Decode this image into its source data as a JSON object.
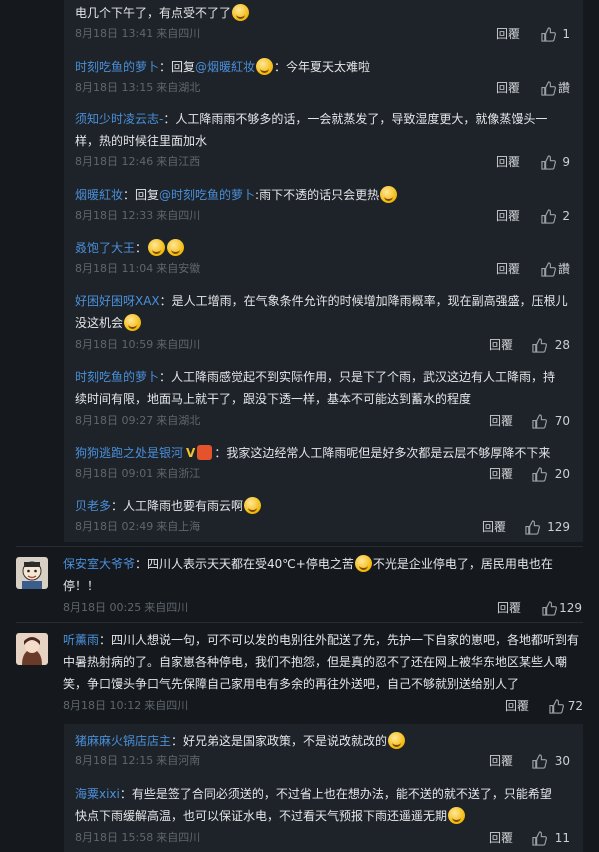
{
  "reply_label": "回覆",
  "like_icon": "thumbs-up-icon",
  "colors": {
    "link": "#4a8fd9",
    "background": "#15191e",
    "panel": "#1e2329",
    "meta": "#5f666e"
  },
  "replies_a": [
    {
      "name": "",
      "text": "电几个下午了，有点受不了了",
      "emoji_after": true,
      "date": "8月18日 13:41",
      "location": "来自四川",
      "likes": "1"
    },
    {
      "name": "时刻吃鱼的萝卜",
      "prefix": "：回复",
      "at": "@烟暖紅妆",
      "text": "：今年夏天太难啦",
      "emoji_mid": true,
      "date": "8月18日 13:15",
      "location": "来自湖北",
      "likes": "讚"
    },
    {
      "name": "须知少时凌云志-",
      "text": "：人工降雨雨不够多的话，一会就蒸发了，导致湿度更大，就像蒸馒头一样，热的时候往里面加水",
      "date": "8月18日 12:46",
      "location": "来自江西",
      "likes": "9"
    },
    {
      "name": "烟暖紅妆",
      "prefix": "：回复",
      "at": "@时刻吃鱼的萝卜",
      "text": ":雨下不透的话只会更热",
      "emoji_after": true,
      "date": "8月18日 12:33",
      "location": "来自四川",
      "likes": "2"
    },
    {
      "name": "叒饱了大王",
      "text": "：",
      "emoji_two": true,
      "date": "8月18日 11:04",
      "location": "来自安徽",
      "likes": "讚"
    },
    {
      "name": "好困好困呀XAX",
      "text": "：是人工增雨，在气象条件允许的时候增加降雨概率，现在副高强盛，压根儿没这机会",
      "emoji_after": true,
      "date": "8月18日 10:59",
      "location": "来自四川",
      "likes": "28"
    },
    {
      "name": "时刻吃鱼的萝卜",
      "text": "：人工降雨感觉起不到实际作用，只是下了个雨，武汉这边有人工降雨，持续时间有限，地面马上就干了，跟没下透一样，基本不可能达到蓄水的程度",
      "date": "8月18日 09:27",
      "location": "来自湖北",
      "likes": "70"
    },
    {
      "name": "狗狗逃跑之处是银河",
      "badge": "V",
      "text": "：我家这边经常人工降雨呢但是好多次都是云层不够厚降不下来",
      "date": "8月18日 09:01",
      "location": "来自浙江",
      "likes": "20"
    },
    {
      "name": "贝老多",
      "text": "：人工降雨也要有雨云啊",
      "emoji_after": true,
      "date": "8月18日 02:49",
      "location": "来自上海",
      "likes": "129"
    }
  ],
  "top_comments": [
    {
      "name": "保安室大爷爷",
      "text": "：四川人表示天天都在受40℃+停电之苦",
      "text2": "不光是企业停电了，居民用电也在停！！",
      "date": "8月18日 00:25",
      "location": "来自四川",
      "likes": "129"
    },
    {
      "name": "听薰雨",
      "text": "：四川人想说一句，可不可以发的电别往外配送了先，先护一下自家的崽吧，各地都听到有中暑热射病的了。自家崽各种停电，我们不抱怨，但是真的忍不了还在网上被华东地区某些人嘲笑，争口馒头争口气先保障自己家用电有多余的再往外送吧，自己不够就别送给别人了",
      "date": "8月18日 10:12",
      "location": "来自四川",
      "likes": "72"
    }
  ],
  "replies_b": [
    {
      "name": "猪麻麻火锅店店主",
      "text": "：好兄弟这是国家政策，不是说改就改的",
      "emoji_after": true,
      "date": "8月18日 12:15",
      "location": "来自河南",
      "likes": "30"
    },
    {
      "name": "海粟xixi",
      "text": "：有些是签了合同必须送的，不过省上也在想办法，能不送的就不送了，只能希望快点下雨缓解高温，也可以保证水电，不过看天气预报下雨还遥遥无期",
      "emoji_after": true,
      "date": "8月18日 15:58",
      "location": "来自四川",
      "likes": "11"
    }
  ]
}
